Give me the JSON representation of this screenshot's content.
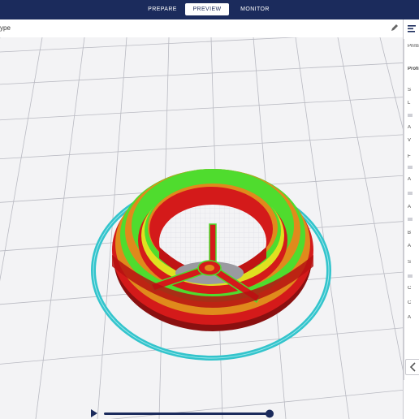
{
  "tabs": [
    {
      "label": "PREPARE",
      "active": false
    },
    {
      "label": "PREVIEW",
      "active": true
    },
    {
      "label": "MONITOR",
      "active": false
    }
  ],
  "toolbar": {
    "label": "ype"
  },
  "sidebar": {
    "header": "Printi",
    "section": "Profi",
    "lines": [
      "S",
      "L",
      "A",
      "V",
      "F",
      "A",
      "A",
      "B",
      "A",
      "S",
      "C",
      "C",
      "A"
    ]
  },
  "icons": {
    "pencil": "pencil-icon",
    "settings": "settings-panel-icon",
    "collapse": "chevron-left-icon",
    "play": "play-icon"
  },
  "colors": {
    "topbar": "#1b2b5c",
    "skirt": "#33c4cc",
    "wall_outer": "#d41a1a",
    "wall_inner": "#4fdc2e",
    "infill": "#e08a1c",
    "skin": "#e0e020",
    "support": "#8c8c8c"
  }
}
